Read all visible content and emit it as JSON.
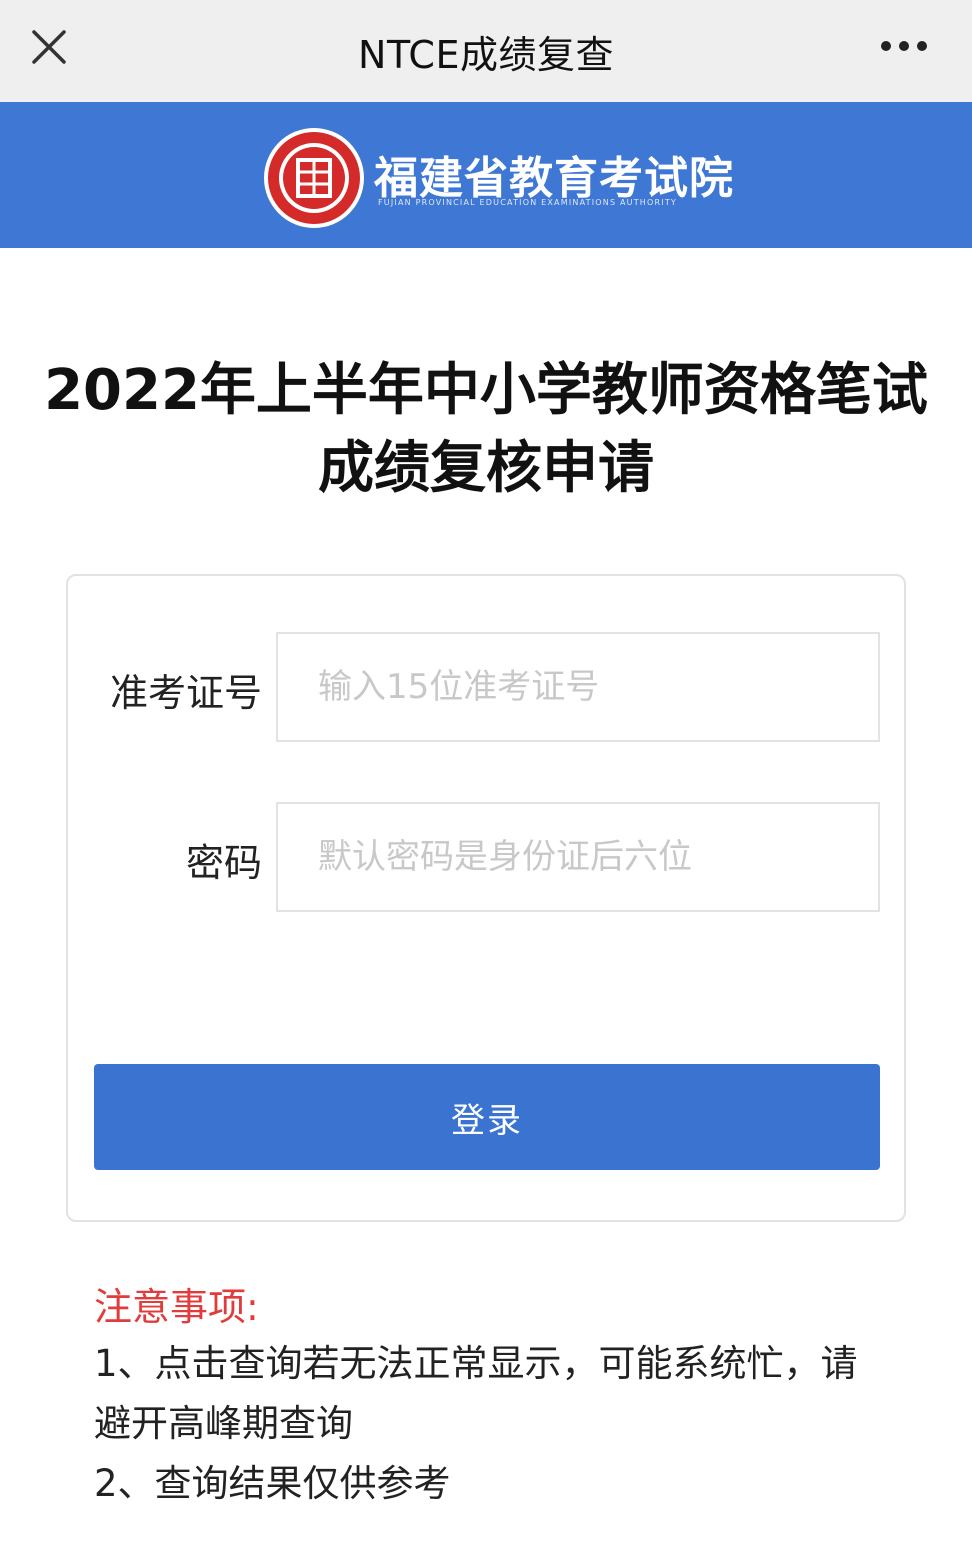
{
  "titlebar": {
    "title": "NTCE成绩复查",
    "close_icon": "close-icon",
    "more_icon": "more-dots-icon"
  },
  "banner": {
    "org_name": "福建省教育考试院",
    "org_name_en": "FUJIAN PROVINCIAL EDUCATION EXAMINATIONS AUTHORITY",
    "color": "#3f78d4",
    "logo_color": "#d42a2a"
  },
  "page": {
    "title": "2022年上半年中小学教师资格笔试成绩复核申请"
  },
  "form": {
    "ticket_label": "准考证号",
    "ticket_placeholder": "输入15位准考证号",
    "ticket_value": "",
    "password_label": "密码",
    "password_placeholder": "默认密码是身份证后六位",
    "password_value": "",
    "login_label": "登录",
    "login_color": "#3a74d0"
  },
  "notice": {
    "title": "注意事项:",
    "title_color": "#e23b3b",
    "items": [
      "1、点击查询若无法正常显示，可能系统忙，请避开高峰期查询",
      "2、查询结果仅供参考"
    ]
  }
}
